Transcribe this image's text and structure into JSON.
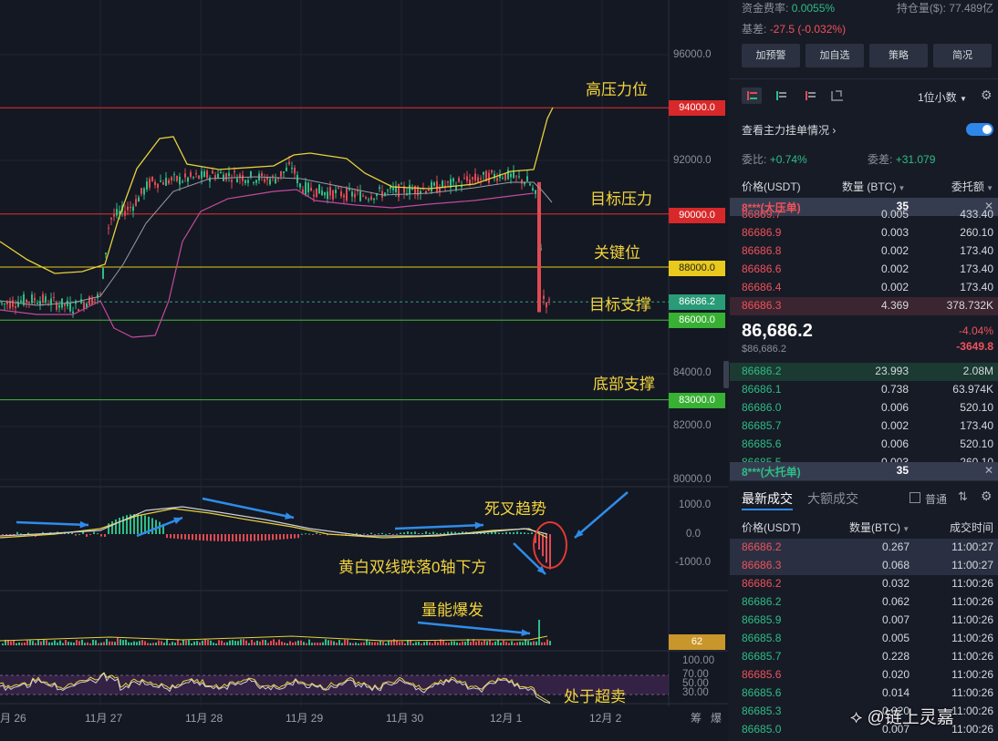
{
  "chart": {
    "price_axis": [
      "96000.0",
      "92000.0",
      "84000.0",
      "82000.0",
      "80000.0"
    ],
    "macd_axis": [
      "1000.0",
      "0.0",
      "-1000.0"
    ],
    "rsi_axis": [
      "100.00",
      "70.00",
      "50.00",
      "30.00"
    ],
    "dates": [
      "月 26",
      "11月 27",
      "11月 28",
      "11月 29",
      "11月 30",
      "12月 1",
      "12月 2"
    ],
    "date_right": [
      "筹",
      "爆"
    ],
    "levels": [
      {
        "value": "94000.0",
        "color": "#e0302e"
      },
      {
        "value": "90000.0",
        "color": "#e0302e"
      },
      {
        "value": "88000.0",
        "color": "#e8c91c"
      },
      {
        "value": "86686.2",
        "color": "#2aa37c"
      },
      {
        "value": "86000.0",
        "color": "#3fba3a"
      },
      {
        "value": "83000.0",
        "color": "#3fba3a"
      }
    ],
    "volume_tag": "62",
    "annotations": {
      "high_pressure": "高压力位",
      "target_pressure": "目标压力",
      "key_level": "关键位",
      "target_support": "目标支撑",
      "bottom_support": "底部支撑",
      "death_cross": "死叉趋势",
      "macd_note": "黄白双线跌落0轴下方",
      "volume_note": "量能爆发",
      "oversold": "处于超卖"
    },
    "watermark": "@链上灵嘉"
  },
  "panel": {
    "funding_label": "资金费率:",
    "funding_value": "0.0055%",
    "oi_label": "持仓量($):",
    "oi_value": "77.489亿",
    "basis_label": "基差:",
    "basis_value": "-27.5 (-0.032%)",
    "buttons": [
      "加预警",
      "加自选",
      "策略",
      "简况"
    ],
    "precision": "1位小数",
    "depth_link": "查看主力挂单情况",
    "ratio_label": "委比:",
    "ratio_value": "+0.74%",
    "diff_label": "委差:",
    "diff_value": "+31.079",
    "headers": {
      "price": "价格(USDT)",
      "qty": "数量 (BTC)",
      "amount": "委托额"
    },
    "big_ask": {
      "label": "8***(大压单)",
      "qty": "35"
    },
    "asks": [
      {
        "price": "86869.7",
        "qty": "0.005",
        "amt": "433.40"
      },
      {
        "price": "86686.9",
        "qty": "0.003",
        "amt": "260.10"
      },
      {
        "price": "86686.8",
        "qty": "0.002",
        "amt": "173.40"
      },
      {
        "price": "86686.6",
        "qty": "0.002",
        "amt": "173.40"
      },
      {
        "price": "86686.4",
        "qty": "0.002",
        "amt": "173.40"
      },
      {
        "price": "86686.3",
        "qty": "4.369",
        "amt": "378.732K"
      }
    ],
    "last_price": "86,686.2",
    "last_price_sub": "$86,686.2",
    "change_pct": "-4.04%",
    "change_abs": "-3649.8",
    "bids": [
      {
        "price": "86686.2",
        "qty": "23.993",
        "amt": "2.08M"
      },
      {
        "price": "86686.1",
        "qty": "0.738",
        "amt": "63.974K"
      },
      {
        "price": "86686.0",
        "qty": "0.006",
        "amt": "520.10"
      },
      {
        "price": "86685.7",
        "qty": "0.002",
        "amt": "173.40"
      },
      {
        "price": "86685.6",
        "qty": "0.006",
        "amt": "520.10"
      },
      {
        "price": "86685.5",
        "qty": "0.003",
        "amt": "260.10"
      }
    ],
    "big_bid": {
      "label": "8***(大托单)",
      "qty": "35"
    },
    "trade_tabs": [
      "最新成交",
      "大额成交"
    ],
    "normal_label": "普通",
    "trade_headers": {
      "price": "价格(USDT)",
      "qty": "数量(BTC)",
      "time": "成交时间"
    },
    "trades": [
      {
        "price": "86686.2",
        "qty": "0.267",
        "time": "11:00:27",
        "side": "red"
      },
      {
        "price": "86686.3",
        "qty": "0.068",
        "time": "11:00:27",
        "side": "red"
      },
      {
        "price": "86686.2",
        "qty": "0.032",
        "time": "11:00:26",
        "side": "red"
      },
      {
        "price": "86686.2",
        "qty": "0.062",
        "time": "11:00:26",
        "side": "green"
      },
      {
        "price": "86685.9",
        "qty": "0.007",
        "time": "11:00:26",
        "side": "green"
      },
      {
        "price": "86685.8",
        "qty": "0.005",
        "time": "11:00:26",
        "side": "green"
      },
      {
        "price": "86685.7",
        "qty": "0.228",
        "time": "11:00:26",
        "side": "green"
      },
      {
        "price": "86685.6",
        "qty": "0.020",
        "time": "11:00:26",
        "side": "red"
      },
      {
        "price": "86685.6",
        "qty": "0.014",
        "time": "11:00:26",
        "side": "green"
      },
      {
        "price": "86685.3",
        "qty": "0.020",
        "time": "11:00:26",
        "side": "green"
      },
      {
        "price": "86685.0",
        "qty": "0.007",
        "time": "11:00:26",
        "side": "green"
      }
    ]
  }
}
